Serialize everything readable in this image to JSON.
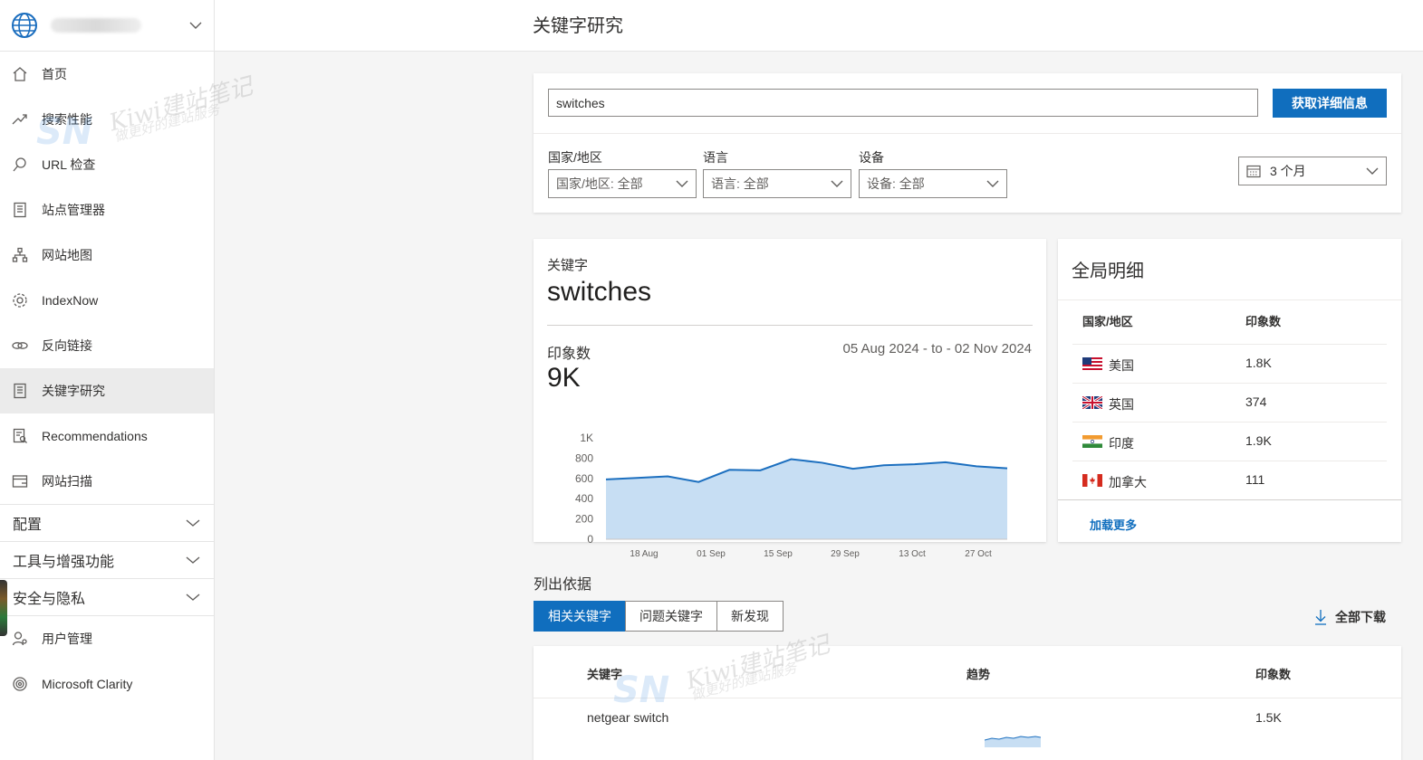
{
  "header": {
    "title": "关键字研究"
  },
  "sidebar": {
    "items": [
      {
        "label": "首页",
        "icon": "home-icon"
      },
      {
        "label": "搜索性能",
        "icon": "trend-icon"
      },
      {
        "label": "URL 检查",
        "icon": "search-icon"
      },
      {
        "label": "站点管理器",
        "icon": "document-icon"
      },
      {
        "label": "网站地图",
        "icon": "sitemap-icon"
      },
      {
        "label": "IndexNow",
        "icon": "gear-icon"
      },
      {
        "label": "反向链接",
        "icon": "link-icon"
      },
      {
        "label": "关键字研究",
        "icon": "document-icon",
        "active": true
      },
      {
        "label": "Recommendations",
        "icon": "report-icon"
      },
      {
        "label": "网站扫描",
        "icon": "scan-icon"
      }
    ],
    "sections": [
      "配置",
      "工具与增强功能",
      "安全与隐私"
    ],
    "bottom_items": [
      {
        "label": "用户管理",
        "icon": "user-icon"
      },
      {
        "label": "Microsoft Clarity",
        "icon": "clarity-icon"
      }
    ]
  },
  "search": {
    "value": "switches",
    "button_label": "获取详细信息",
    "filters": [
      {
        "label": "国家/地区",
        "value": "国家/地区: 全部"
      },
      {
        "label": "语言",
        "value": "语言: 全部"
      },
      {
        "label": "设备",
        "value": "设备: 全部"
      }
    ],
    "date_range": "3 个月"
  },
  "keyword_card": {
    "label": "关键字",
    "keyword": "switches",
    "impressions_label": "印象数",
    "impressions_value": "9K",
    "date_range": "05 Aug 2024 - to - 02 Nov 2024"
  },
  "chart_data": {
    "type": "area",
    "title": "",
    "xlabel": "",
    "ylabel": "",
    "ylim": [
      0,
      1000
    ],
    "y_ticks": [
      "0",
      "200",
      "400",
      "600",
      "800",
      "1K"
    ],
    "x_ticks": [
      "18 Aug",
      "01 Sep",
      "15 Sep",
      "29 Sep",
      "13 Oct",
      "27 Oct"
    ],
    "x": [
      "05 Aug",
      "12 Aug",
      "19 Aug",
      "26 Aug",
      "02 Sep",
      "09 Sep",
      "16 Sep",
      "23 Sep",
      "30 Sep",
      "07 Oct",
      "14 Oct",
      "21 Oct",
      "28 Oct",
      "02 Nov"
    ],
    "series": [
      {
        "values": [
          590,
          605,
          620,
          565,
          685,
          680,
          790,
          755,
          695,
          730,
          740,
          760,
          720,
          700
        ]
      }
    ],
    "colors": {
      "line": "#1c6fbf",
      "fill": "#c7def3"
    }
  },
  "global_breakdown": {
    "title": "全局明细",
    "col_country": "国家/地区",
    "col_impressions": "印象数",
    "rows": [
      {
        "country": "美国",
        "flag": "us-flag-icon",
        "impressions": "1.8K"
      },
      {
        "country": "英国",
        "flag": "uk-flag-icon",
        "impressions": "374"
      },
      {
        "country": "印度",
        "flag": "india-flag-icon",
        "impressions": "1.9K"
      },
      {
        "country": "加拿大",
        "flag": "canada-flag-icon",
        "impressions": "111"
      }
    ],
    "load_more": "加载更多"
  },
  "list_by": {
    "label": "列出依据",
    "tabs": [
      "相关关键字",
      "问题关键字",
      "新发现"
    ],
    "download_all": "全部下载"
  },
  "table": {
    "headers": [
      "关键字",
      "趋势",
      "印象数"
    ],
    "rows": [
      {
        "keyword": "netgear switch",
        "impressions": "1.5K"
      }
    ]
  },
  "watermark": {
    "title": "Kiwi建站笔记",
    "subtitle": "做更好的建站服务"
  }
}
